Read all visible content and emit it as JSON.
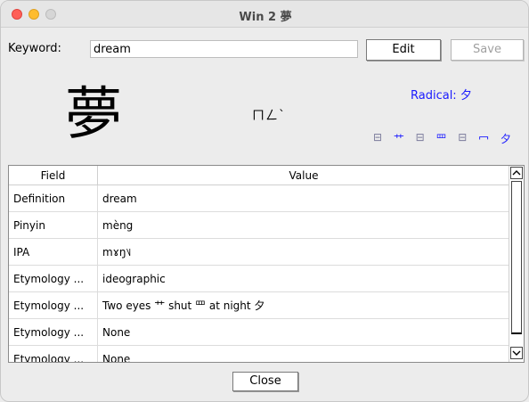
{
  "window": {
    "title": "Win 2 夢"
  },
  "keyword": {
    "label": "Keyword:",
    "value": "dream"
  },
  "buttons": {
    "edit": "Edit",
    "save": "Save",
    "close": "Close"
  },
  "character": {
    "glyph": "夢",
    "zhuyin": "ㄇㄥˋ",
    "radical_label": "Radical: 夕",
    "components": [
      "⊟",
      "艹",
      "⊟",
      "罒",
      "⊟",
      "冖",
      "夕"
    ]
  },
  "table": {
    "headers": [
      "Field",
      "Value"
    ],
    "rows": [
      {
        "field": "Definition",
        "value": "dream"
      },
      {
        "field": "Pinyin",
        "value": "mèng"
      },
      {
        "field": "IPA",
        "value": "mɤŋ˥˩"
      },
      {
        "field": "Etymology ...",
        "value": "ideographic"
      },
      {
        "field": "Etymology ...",
        "value": "Two eyes 艹 shut 罒 at night 夕"
      },
      {
        "field": "Etymology ...",
        "value": "None"
      },
      {
        "field": "Etymology ...",
        "value": "None"
      }
    ]
  },
  "colors": {
    "link_blue": "#1a1aff",
    "window_bg": "#ececec"
  },
  "icons": {
    "scroll_up": "scroll-up-arrow-icon",
    "scroll_down": "scroll-down-arrow-icon"
  }
}
